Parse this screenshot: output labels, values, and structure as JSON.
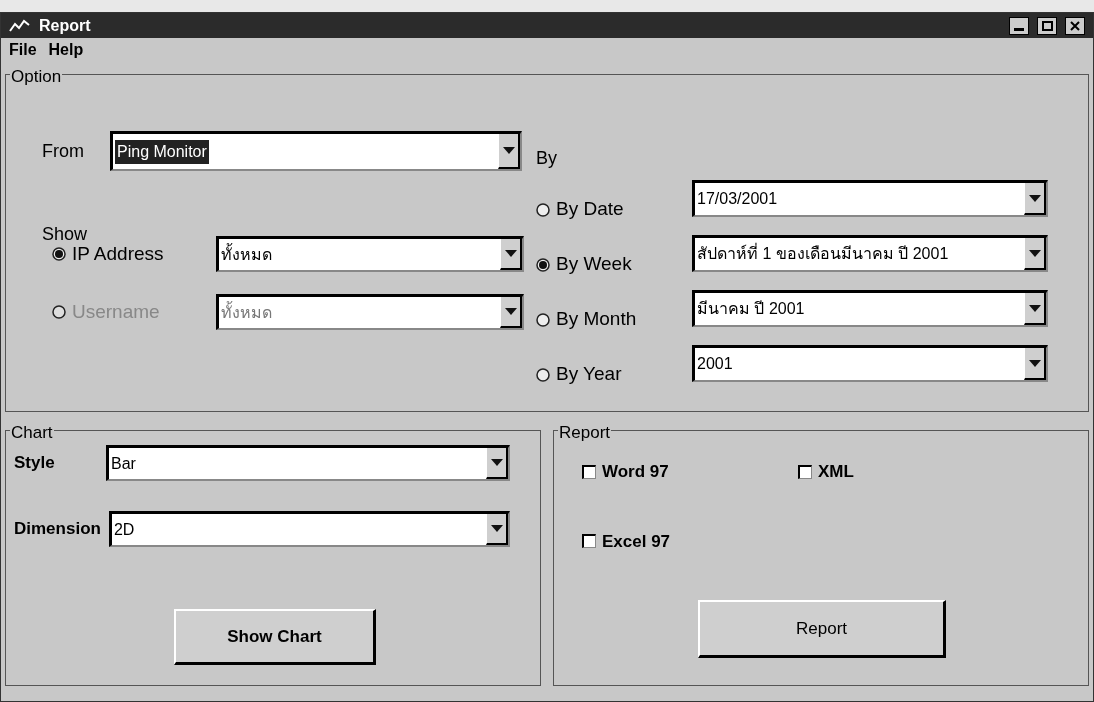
{
  "window": {
    "title": "Report"
  },
  "menu": [
    {
      "label": "File"
    },
    {
      "label": "Help"
    }
  ],
  "option": {
    "title": "Option",
    "from": {
      "label": "From",
      "value": "Ping Monitor",
      "highlighted": true
    },
    "show": {
      "label": "Show",
      "rows": [
        {
          "label": "IP Address",
          "selected": true,
          "disabled": false,
          "value": "ทั้งหมด"
        },
        {
          "label": "Username",
          "selected": false,
          "disabled": true,
          "value": "ทั้งหมด"
        }
      ]
    },
    "by": {
      "label": "By",
      "rows": [
        {
          "label": "By Date",
          "selected": false,
          "value": "17/03/2001"
        },
        {
          "label": "By Week",
          "selected": true,
          "value": "สัปดาห์ที่ 1 ของเดือนมีนาคม ปี 2001"
        },
        {
          "label": "By Month",
          "selected": false,
          "value": "มีนาคม ปี 2001"
        },
        {
          "label": "By Year",
          "selected": false,
          "value": "2001"
        }
      ]
    }
  },
  "chart": {
    "title": "Chart",
    "fields": [
      {
        "label": "Style",
        "value": "Bar"
      },
      {
        "label": "Dimension",
        "value": "2D"
      }
    ],
    "button": "Show Chart"
  },
  "report": {
    "title": "Report",
    "checkboxes": [
      {
        "label": "Word 97",
        "checked": false
      },
      {
        "label": "XML",
        "checked": false
      },
      {
        "label": "Excel 97",
        "checked": false
      }
    ],
    "button": "Report"
  }
}
